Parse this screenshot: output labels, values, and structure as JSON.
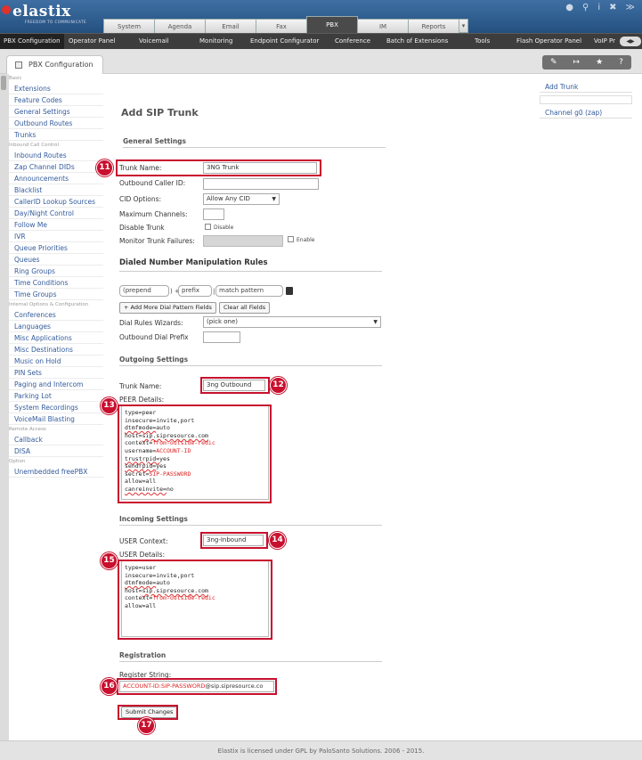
{
  "brand": {
    "logo_text": "elastix",
    "tagline": "FREEDOM TO COMMUNICATE"
  },
  "top_tabs": [
    "System",
    "Agenda",
    "Email",
    "Fax",
    "PBX",
    "IM",
    "Reports"
  ],
  "sub_menu": [
    "PBX Configuration",
    "Operator Panel",
    "Voicemail",
    "Monitoring",
    "Endpoint Configurator",
    "Conference",
    "Batch of Extensions",
    "Tools",
    "Flash Operator Panel",
    "VoIP Pr"
  ],
  "module": {
    "tab_label": "PBX Configuration"
  },
  "sidebar": {
    "sections": [
      {
        "title": "Basic",
        "items": [
          "Extensions",
          "Feature Codes",
          "General Settings",
          "Outbound Routes",
          "Trunks"
        ]
      },
      {
        "title": "Inbound Call Control",
        "items": [
          "Inbound Routes",
          "Zap Channel DIDs",
          "Announcements",
          "Blacklist",
          "CallerID Lookup Sources",
          "Day/Night Control",
          "Follow Me",
          "IVR",
          "Queue Priorities",
          "Queues",
          "Ring Groups",
          "Time Conditions",
          "Time Groups"
        ]
      },
      {
        "title": "Internal Options & Configuration",
        "items": [
          "Conferences",
          "Languages",
          "Misc Applications",
          "Misc Destinations",
          "Music on Hold",
          "PIN Sets",
          "Paging and Intercom",
          "Parking Lot",
          "System Recordings",
          "VoiceMail Blasting"
        ]
      },
      {
        "title": "Remote Access",
        "items": [
          "Callback",
          "DISA"
        ]
      },
      {
        "title": "Option",
        "items": [
          "Unembedded freePBX"
        ]
      }
    ]
  },
  "right_panel": {
    "add_link": "Add Trunk",
    "channel_link": "Channel g0 (zap)"
  },
  "form": {
    "title": "Add SIP Trunk",
    "general_header": "General Settings",
    "trunk_name_label": "Trunk Name:",
    "trunk_name_value": "3NG Trunk",
    "outbound_cid_label": "Outbound Caller ID:",
    "cid_options_label": "CID Options:",
    "cid_options_value": "Allow Any CID",
    "max_channels_label": "Maximum Channels:",
    "disable_trunk_label": "Disable Trunk",
    "disable_text": "Disable",
    "monitor_label": "Monitor Trunk Failures:",
    "enable_text": "Enable",
    "dial_rules_header": "Dialed Number Manipulation Rules",
    "prepend_placeholder": "(prepend",
    "paren_plus": ") +",
    "prefix_placeholder": "prefix",
    "pipe_sep": "|",
    "match_placeholder": "match pattern",
    "add_more_button": "+ Add More Dial Pattern Fields",
    "clear_all_button": "Clear all Fields",
    "wizards_label": "Dial Rules Wizards:",
    "wizards_value": "(pick one)",
    "outbound_prefix_label": "Outbound Dial Prefix",
    "outgoing_header": "Outgoing Settings",
    "out_trunk_name_label": "Trunk Name:",
    "out_trunk_name_value": "3ng Outbound",
    "peer_details_label": "PEER Details:",
    "incoming_header": "Incoming Settings",
    "user_context_label": "USER Context:",
    "user_context_value": "3ng-Inbound",
    "user_details_label": "USER Details:",
    "registration_header": "Registration",
    "register_label": "Register String:",
    "register_part1": "ACCOUNT-ID:SIP-PASSWORD",
    "register_part2": "@sip.sipresource.co",
    "submit_button": "Submit Changes"
  },
  "peer_lines": [
    "type=peer",
    "insecure=invite,port",
    "dtmfmode=auto",
    "host=sip.sipresource.com",
    "context=from-outside-redic",
    "username=ACCOUNT-ID",
    "trustrpid=yes",
    "sendrpid=yes",
    "secret=SIP-PASSWORD",
    "allow=all",
    "canreinvite=no"
  ],
  "user_lines": [
    "type=user",
    "insecure=invite,port",
    "dtmfmode=auto",
    "host=sip.sipresource.com",
    "context=from-outside-redic",
    "allow=all"
  ],
  "badges": [
    "11",
    "12",
    "13",
    "14",
    "15",
    "16",
    "17"
  ],
  "footer": {
    "text": "Elastix is licensed under GPL by PaloSanto Solutions. 2006 - 2015."
  },
  "colors": {
    "header": "#2f5f92",
    "annotation_red": "#c8102e",
    "link": "#335b9c"
  }
}
